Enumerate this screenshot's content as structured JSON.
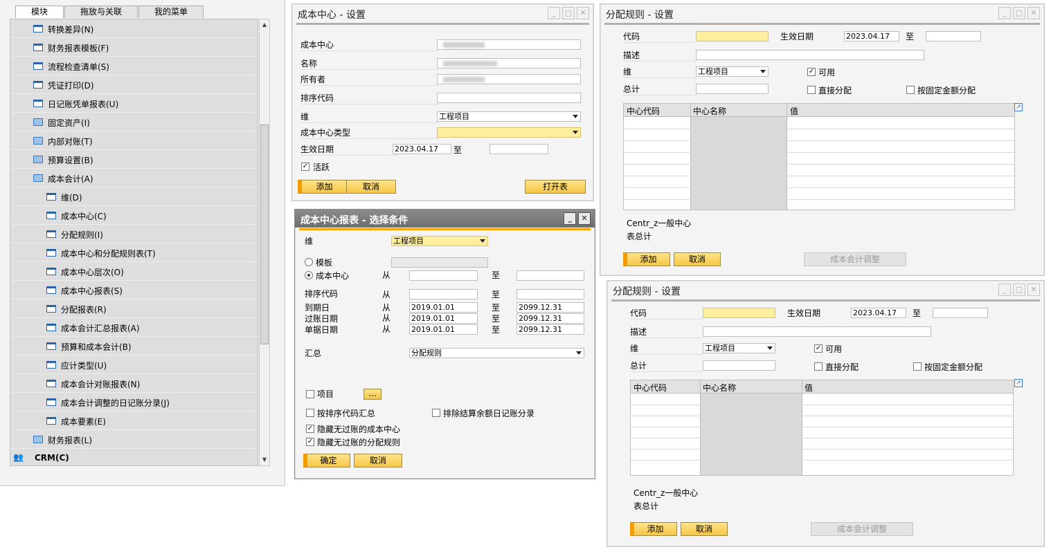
{
  "sidebar": {
    "tabs": [
      "模块",
      "拖放与关联",
      "我的菜单"
    ],
    "items": [
      {
        "label": "转换差异(N)",
        "icon": "form-icon"
      },
      {
        "label": "财务报表模板(F)",
        "icon": "form-icon"
      },
      {
        "label": "流程检查清单(S)",
        "icon": "form-icon"
      },
      {
        "label": "凭证打印(D)",
        "icon": "form-icon"
      },
      {
        "label": "日记账凭单报表(U)",
        "icon": "form-icon"
      },
      {
        "label": "固定资产(I)",
        "icon": "folder-icon"
      },
      {
        "label": "内部对账(T)",
        "icon": "folder-icon"
      },
      {
        "label": "预算设置(B)",
        "icon": "folder-icon"
      },
      {
        "label": "成本会计(A)",
        "icon": "folder-open-icon"
      },
      {
        "label": "维(D)",
        "icon": "form-icon"
      },
      {
        "label": "成本中心(C)",
        "icon": "form-icon"
      },
      {
        "label": "分配规则(I)",
        "icon": "form-icon"
      },
      {
        "label": "成本中心和分配规则表(T)",
        "icon": "form-icon"
      },
      {
        "label": "成本中心层次(O)",
        "icon": "form-icon"
      },
      {
        "label": "成本中心报表(S)",
        "icon": "form-icon"
      },
      {
        "label": "分配报表(R)",
        "icon": "form-icon"
      },
      {
        "label": "成本会计汇总报表(A)",
        "icon": "form-icon"
      },
      {
        "label": "预算和成本会计(B)",
        "icon": "form-icon"
      },
      {
        "label": "应计类型(U)",
        "icon": "form-icon"
      },
      {
        "label": "成本会计对账报表(N)",
        "icon": "form-icon"
      },
      {
        "label": "成本会计调整的日记账分录(J)",
        "icon": "form-icon"
      },
      {
        "label": "成本要素(E)",
        "icon": "form-icon"
      },
      {
        "label": "财务报表(L)",
        "icon": "folder-icon"
      },
      {
        "label": "CRM(C)",
        "icon": "crm-users-icon"
      }
    ]
  },
  "cost_center_setup": {
    "title": "成本中心 - 设置",
    "labels": {
      "cost_center": "成本中心",
      "name": "名称",
      "owner": "所有者",
      "sort_code": "排序代码",
      "dimension": "维",
      "type": "成本中心类型",
      "effective_date": "生效日期",
      "to": "至",
      "active": "活跃"
    },
    "values": {
      "dimension": "工程项目",
      "effective_from": "2023.04.17",
      "effective_to": ""
    },
    "buttons": {
      "add": "添加",
      "cancel": "取消",
      "open_table": "打开表"
    }
  },
  "cost_center_report": {
    "title": "成本中心报表 - 选择条件",
    "labels": {
      "dimension": "维",
      "template": "模板",
      "cost_center": "成本中心",
      "from": "从",
      "to": "至",
      "sort_code": "排序代码",
      "due_date": "到期日",
      "posting_date": "过账日期",
      "doc_date": "单据日期",
      "summary": "汇总",
      "project": "项目",
      "by_sort_code": "按排序代码汇总",
      "exclude_closing": "排除结算余额日记账分录",
      "hide_cc": "隐藏无过账的成本中心",
      "hide_rules": "隐藏无过账的分配规则"
    },
    "values": {
      "dimension": "工程项目",
      "due_from": "2019.01.01",
      "due_to": "2099.12.31",
      "posting_from": "2019.01.01",
      "posting_to": "2099.12.31",
      "doc_from": "2019.01.01",
      "doc_to": "2099.12.31",
      "summary": "分配规则",
      "ellipsis": "..."
    },
    "buttons": {
      "ok": "确定",
      "cancel": "取消"
    }
  },
  "distribution_rule": {
    "title": "分配规则 - 设置",
    "labels": {
      "code": "代码",
      "effective_date": "生效日期",
      "to": "至",
      "description": "描述",
      "dimension": "维",
      "total": "总计",
      "active": "可用",
      "direct": "直接分配",
      "fixed": "按固定金额分配"
    },
    "values": {
      "effective_from": "2023.04.17",
      "dimension": "工程项目"
    },
    "grid_headers": [
      "中心代码",
      "中心名称",
      "值"
    ],
    "footer": {
      "centre": "Centr_z一般中心",
      "table_total": "表总计"
    },
    "buttons": {
      "add": "添加",
      "cancel": "取消",
      "adjust": "成本会计调整"
    }
  },
  "colors": {
    "accent": "#f39c00",
    "yellow_field": "#fdeea0",
    "button": "#f6c646"
  }
}
